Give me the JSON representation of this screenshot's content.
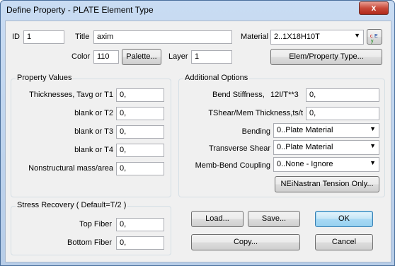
{
  "window": {
    "title": "Define Property - PLATE Element Type",
    "close_glyph": "x"
  },
  "header": {
    "id_label": "ID",
    "id_value": "1",
    "title_label": "Title",
    "title_value": "axim",
    "material_label": "Material",
    "material_value": "2..1X18H10T",
    "color_label": "Color",
    "color_value": "110",
    "palette_button": "Palette...",
    "layer_label": "Layer",
    "layer_value": "1",
    "elem_type_button": "Elem/Property Type..."
  },
  "property_values": {
    "title": "Property Values",
    "rows": [
      {
        "label": "Thicknesses, Tavg or T1",
        "value": "0,"
      },
      {
        "label": "blank or T2",
        "value": "0,"
      },
      {
        "label": "blank or T3",
        "value": "0,"
      },
      {
        "label": "blank or T4",
        "value": "0,"
      },
      {
        "label": "Nonstructural mass/area",
        "value": "0,"
      }
    ]
  },
  "additional_options": {
    "title": "Additional Options",
    "bend_stiffness_label": "Bend Stiffness,",
    "bend_stiffness_hint": "12I/T**3",
    "bend_stiffness_value": "0,",
    "tshear_label": "TShear/Mem Thickness,ts/t",
    "tshear_value": "0,",
    "bending_label": "Bending",
    "bending_value": "0..Plate Material",
    "transverse_shear_label": "Transverse Shear",
    "transverse_shear_value": "0..Plate Material",
    "memb_bend_label": "Memb-Bend Coupling",
    "memb_bend_value": "0..None - Ignore",
    "nei_button": "NEiNastran Tension Only..."
  },
  "stress_recovery": {
    "title": "Stress Recovery ( Default=T/2 )",
    "top_fiber_label": "Top Fiber",
    "top_fiber_value": "0,",
    "bottom_fiber_label": "Bottom Fiber",
    "bottom_fiber_value": "0,"
  },
  "buttons": {
    "load": "Load...",
    "save": "Save...",
    "ok": "OK",
    "copy": "Copy...",
    "cancel": "Cancel"
  },
  "icons": {
    "dropdown": "chevron-down-icon",
    "material_lookup": "material-lookup-icon"
  }
}
